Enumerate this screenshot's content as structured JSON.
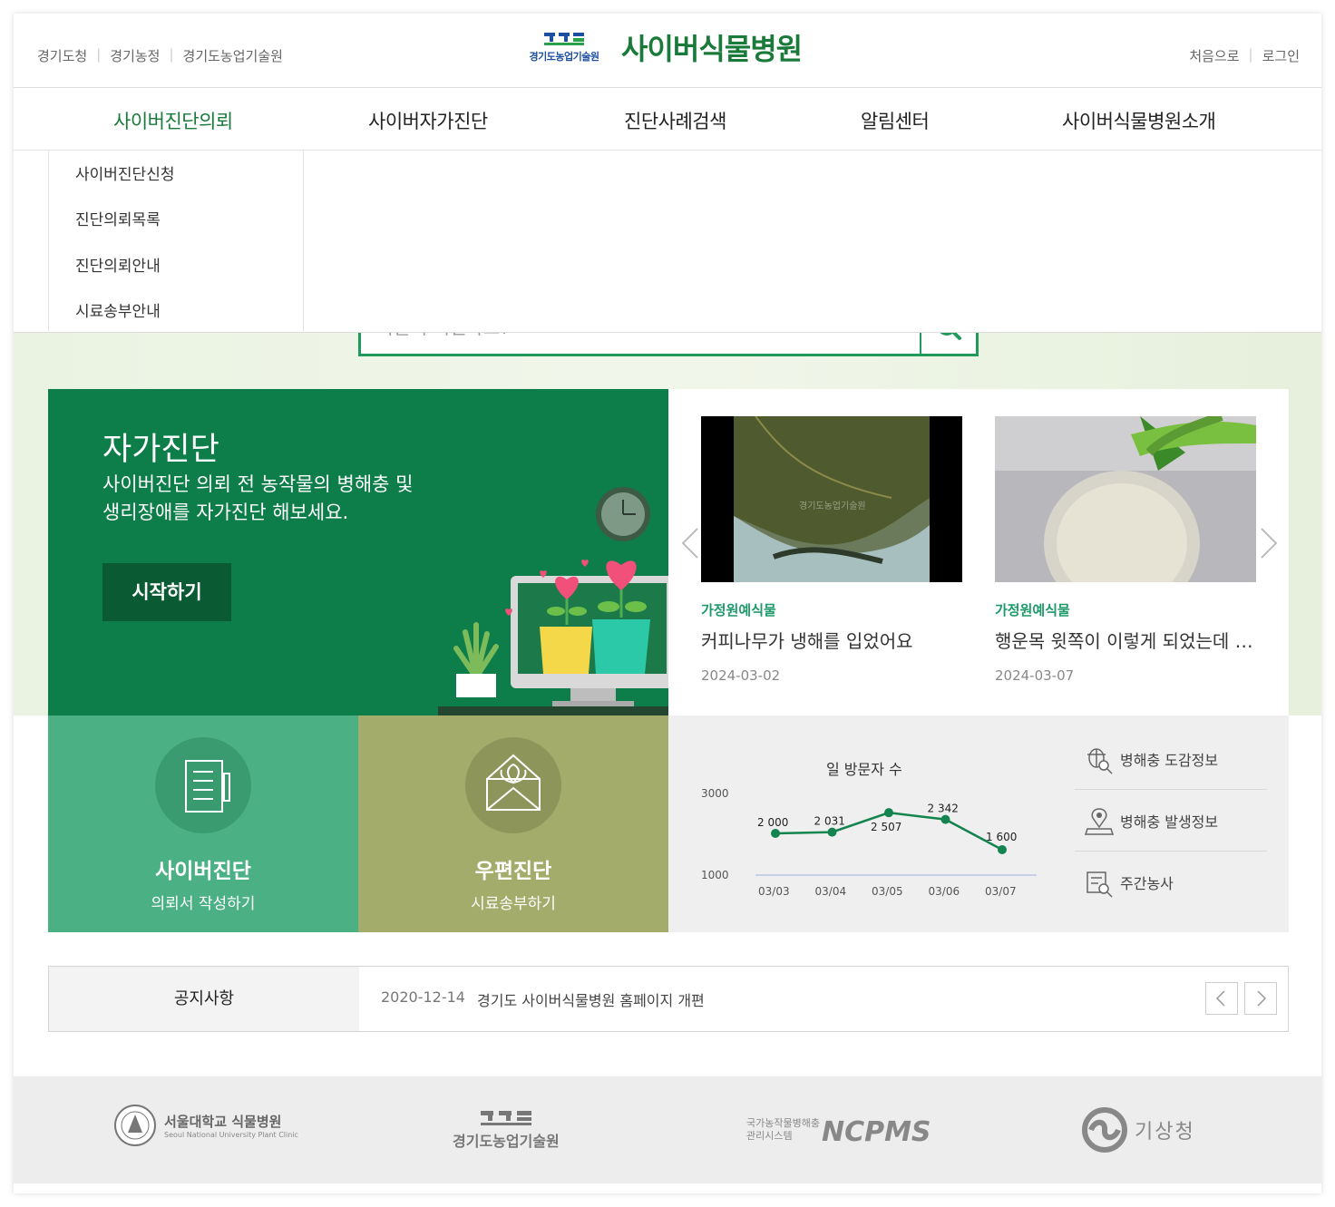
{
  "header": {
    "top_links_left": [
      "경기도청",
      "경기농정",
      "경기도농업기술원"
    ],
    "top_links_right": [
      "처음으로",
      "로그인"
    ],
    "logo_org": "경기도농업기술원",
    "logo_title": "사이버식물병원",
    "brand_color": "#1a7a3a"
  },
  "nav": {
    "items": [
      "사이버진단의뢰",
      "사이버자가진단",
      "진단사례검색",
      "알림센터",
      "사이버식물병원소개"
    ],
    "active_index": 0
  },
  "submenu": {
    "items": [
      "사이버진단신청",
      "진단의뢰목록",
      "진단의뢰안내",
      "시료송부안내"
    ]
  },
  "search": {
    "placeholder_visible": "작물이 어떤가요?"
  },
  "self_diagnosis": {
    "title": "자가진단",
    "description_line1": "사이버진단 의뢰 전 농작물의 병해충 및",
    "description_line2": "생리장애를 자가진단 해보세요.",
    "button_label": "시작하기"
  },
  "cases": [
    {
      "category": "가정원예식물",
      "title": "커피나무가 냉해를 입었어요",
      "date": "2024-03-02",
      "watermark": "경기도농업기술원"
    },
    {
      "category": "가정원예식물",
      "title": "행운목 윗쪽이 이렇게 되었는데 …",
      "date": "2024-03-07"
    }
  ],
  "tiles": [
    {
      "title": "사이버진단",
      "subtitle": "의뢰서 작성하기"
    },
    {
      "title": "우편진단",
      "subtitle": "시료송부하기"
    }
  ],
  "visitors": {
    "title": "일 방문자 수"
  },
  "chart_data": {
    "type": "line",
    "title": "일 방문자 수",
    "x": [
      "03/03",
      "03/04",
      "03/05",
      "03/06",
      "03/07"
    ],
    "series": [
      {
        "values": [
          2000,
          2031,
          2507,
          2342,
          1600
        ]
      }
    ],
    "data_labels": [
      "2 000",
      "2 031",
      "2 507",
      "2 342",
      "1 600"
    ],
    "y_ticks": [
      "3000",
      "1000"
    ],
    "ylim": [
      1000,
      3000
    ],
    "color": "#13834f"
  },
  "quick_links": [
    "병해충 도감정보",
    "병해충 발생정보",
    "주간농사"
  ],
  "notice": {
    "label": "공지사항",
    "date": "2020-12-14",
    "text": "경기도 사이버식물병원 홈페이지 개편"
  },
  "footer": {
    "partners": [
      {
        "name": "서울대학교 식물병원",
        "sub": "Seoul National University Plant Clinic"
      },
      {
        "name": "경기도농업기술원"
      },
      {
        "name": "NCPMS",
        "sub1": "국가농작물병해충",
        "sub2": "관리시스템"
      },
      {
        "name": "기상청"
      }
    ]
  }
}
